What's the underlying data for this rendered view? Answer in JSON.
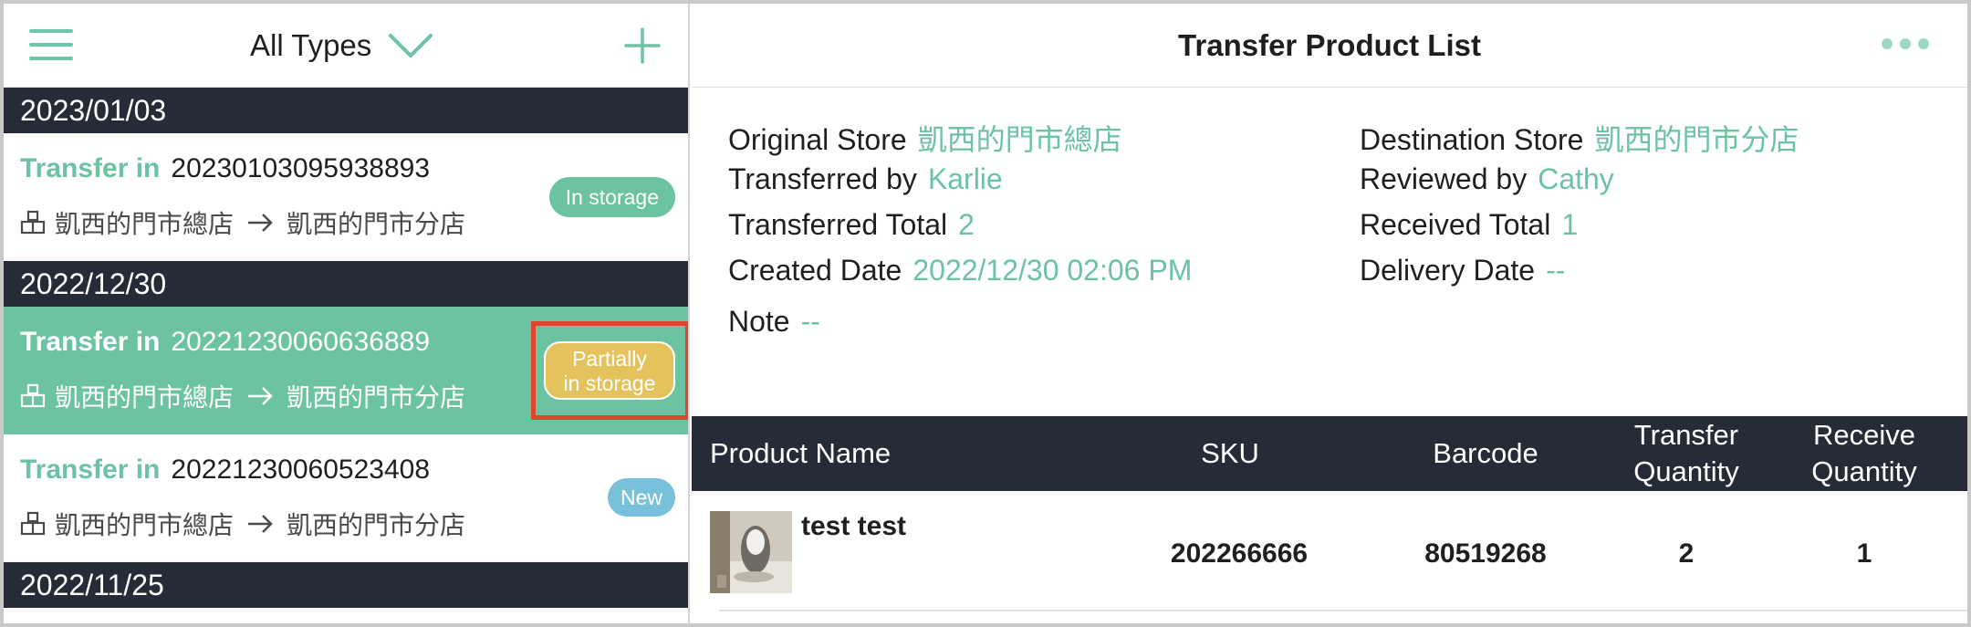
{
  "sidebar": {
    "filter_label": "All Types",
    "groups": [
      {
        "date": "2023/01/03"
      },
      {
        "date": "2022/12/30"
      },
      {
        "date": "2022/11/25"
      }
    ],
    "items": [
      {
        "type": "Transfer in",
        "id": "20230103095938893",
        "from": "凱西的門市總店",
        "to": "凱西的門市分店",
        "status": "In storage"
      },
      {
        "type": "Transfer in",
        "id": "20221230060636889",
        "from": "凱西的門市總店",
        "to": "凱西的門市分店",
        "status_line1": "Partially",
        "status_line2": "in storage"
      },
      {
        "type": "Transfer in",
        "id": "20221230060523408",
        "from": "凱西的門市總店",
        "to": "凱西的門市分店",
        "status": "New"
      }
    ]
  },
  "detail": {
    "title": "Transfer Product List",
    "original_store_label": "Original Store",
    "original_store": "凱西的門市總店",
    "destination_store_label": "Destination Store",
    "destination_store": "凱西的門市分店",
    "transferred_by_label": "Transferred by",
    "transferred_by": "Karlie",
    "reviewed_by_label": "Reviewed by",
    "reviewed_by": "Cathy",
    "transferred_total_label": "Transferred Total",
    "transferred_total": "2",
    "received_total_label": "Received Total",
    "received_total": "1",
    "created_date_label": "Created Date",
    "created_date": "2022/12/30 02:06 PM",
    "delivery_date_label": "Delivery Date",
    "delivery_date": "--",
    "note_label": "Note",
    "note": "--"
  },
  "table": {
    "headers": {
      "name": "Product Name",
      "sku": "SKU",
      "barcode": "Barcode",
      "transfer_qty_1": "Transfer",
      "transfer_qty_2": "Quantity",
      "receive_qty_1": "Receive",
      "receive_qty_2": "Quantity"
    },
    "rows": [
      {
        "name": "test test",
        "sku": "202266666",
        "barcode": "80519268",
        "transfer_qty": "2",
        "receive_qty": "1"
      }
    ]
  },
  "colors": {
    "accent": "#6cc3a1",
    "dark_bar": "#252c38",
    "badge_blue": "#79c0da",
    "badge_yellow": "#e5c35c",
    "highlight": "#e0452c"
  },
  "icons": [
    "hamburger-menu-icon",
    "chevron-down-icon",
    "plus-icon",
    "store-icon",
    "arrow-right-icon",
    "more-icon"
  ]
}
